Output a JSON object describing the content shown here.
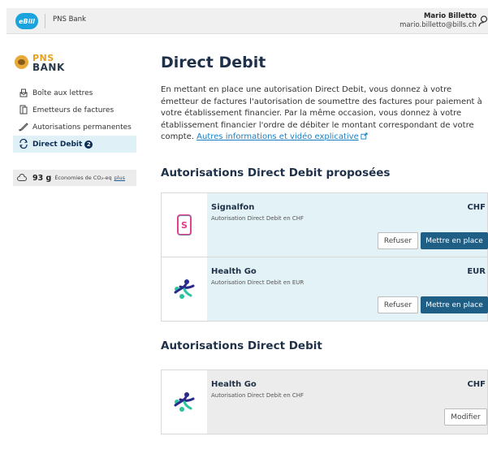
{
  "header": {
    "logo_text": "eBill",
    "bank_name": "PNS Bank",
    "user_name": "Mario Billetto",
    "user_email": "mario.billetto@bills.ch"
  },
  "brand": {
    "line1": "PNS",
    "line2": "BANK"
  },
  "sidebar": {
    "items": [
      {
        "label": "Boîte aux lettres",
        "icon": "mailbox-icon"
      },
      {
        "label": "Emetteurs de factures",
        "icon": "document-icon"
      },
      {
        "label": "Autorisations permanentes",
        "icon": "signature-icon"
      },
      {
        "label": "Direct Debit",
        "icon": "sync-icon",
        "badge": "2",
        "active": true
      }
    ],
    "co2": {
      "value": "93 g",
      "label": "Économies de CO₂-eq",
      "link": "plus"
    }
  },
  "main": {
    "title": "Direct Debit",
    "intro": "En mettant en place une autorisation Direct Debit, vous donnez à votre émetteur de factures l'autorisation de soumettre des factures pour paiement à votre établissement financier. Par la même occasion, vous donnez à votre établissement financier l'ordre de débiter le montant correspondant de votre compte.",
    "intro_link": "Autres informations et vidéo explicative",
    "proposed_title": "Autorisations Direct Debit proposées",
    "proposed": [
      {
        "name": "Signalfon",
        "subtitle": "Autorisation Direct Debit en CHF",
        "currency": "CHF",
        "reject_label": "Refuser",
        "accept_label": "Mettre en place",
        "icon": "phone-app-icon"
      },
      {
        "name": "Health Go",
        "subtitle": "Autorisation Direct Debit en EUR",
        "currency": "EUR",
        "reject_label": "Refuser",
        "accept_label": "Mettre en place",
        "icon": "health-go-icon"
      }
    ],
    "active_title": "Autorisations Direct Debit",
    "active": [
      {
        "name": "Health Go",
        "subtitle": "Autorisation Direct Debit en CHF",
        "currency": "CHF",
        "modify_label": "Modifier",
        "icon": "health-go-icon"
      }
    ]
  },
  "colors": {
    "accent": "#1f5f86",
    "highlight": "#e2f2f7",
    "muted": "#ececec",
    "ebill": "#1aa3dd"
  }
}
